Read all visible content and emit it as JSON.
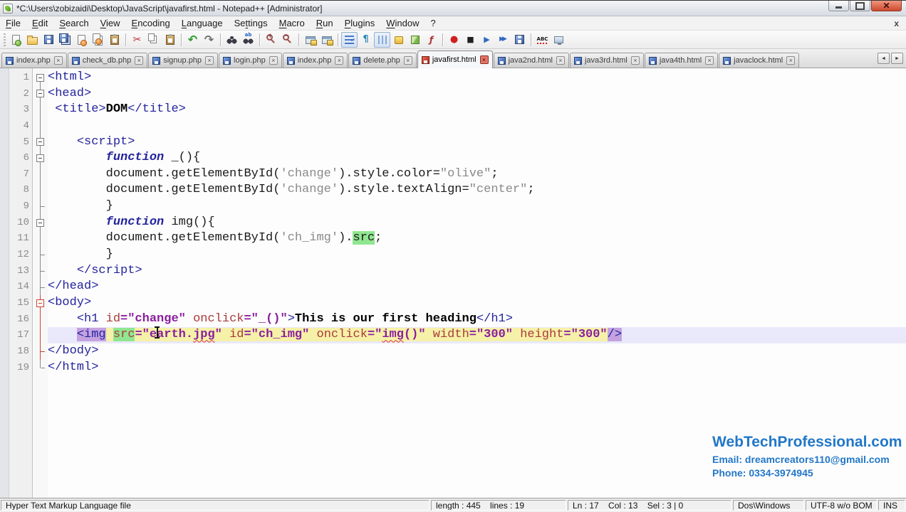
{
  "window": {
    "title": "*C:\\Users\\zobizaidi\\Desktop\\JavaScript\\javafirst.html - Notepad++ [Administrator]"
  },
  "menu": {
    "items": [
      {
        "label": "File",
        "u": 0
      },
      {
        "label": "Edit",
        "u": 0
      },
      {
        "label": "Search",
        "u": 0
      },
      {
        "label": "View",
        "u": 0
      },
      {
        "label": "Encoding",
        "u": 0
      },
      {
        "label": "Language",
        "u": 0
      },
      {
        "label": "Settings",
        "u": 2
      },
      {
        "label": "Macro",
        "u": 0
      },
      {
        "label": "Run",
        "u": 0
      },
      {
        "label": "Plugins",
        "u": 0
      },
      {
        "label": "Window",
        "u": 0
      },
      {
        "label": "?",
        "u": -1
      }
    ],
    "close_label": "x"
  },
  "toolbar": {
    "buttons": [
      {
        "name": "new-file",
        "k": "page"
      },
      {
        "name": "open-file",
        "k": "folder"
      },
      {
        "name": "save-file",
        "k": "floppy"
      },
      {
        "name": "save-all",
        "k": "floppy2"
      },
      {
        "name": "close-file",
        "k": "closedoc"
      },
      {
        "name": "close-all",
        "k": "closeall"
      },
      {
        "name": "print",
        "k": "paste"
      },
      {
        "sep": 1
      },
      {
        "name": "cut",
        "k": "cut",
        "g": "✂"
      },
      {
        "name": "copy",
        "k": "copy"
      },
      {
        "name": "paste",
        "k": "paste"
      },
      {
        "sep": 1
      },
      {
        "name": "undo",
        "k": "undo",
        "g": "↶"
      },
      {
        "name": "redo",
        "k": "redo",
        "g": "↷"
      },
      {
        "sep": 1
      },
      {
        "name": "find",
        "k": "find"
      },
      {
        "name": "replace",
        "k": "replace"
      },
      {
        "sep": 1
      },
      {
        "name": "zoom-in",
        "k": "zoomin"
      },
      {
        "name": "zoom-out",
        "k": "zoomout"
      },
      {
        "sep": 1
      },
      {
        "name": "sync-vertical-scrolling",
        "k": "sync"
      },
      {
        "name": "sync-horizontal-scrolling",
        "k": "sync"
      },
      {
        "sep": 1
      },
      {
        "name": "word-wrap",
        "k": "wrap",
        "pressed": 1
      },
      {
        "name": "show-all-characters",
        "k": "pilcrow",
        "g": "¶"
      },
      {
        "name": "show-indent-guide",
        "k": "guide",
        "pressed": 1
      },
      {
        "name": "define-your-language",
        "k": "lang"
      },
      {
        "name": "document-map",
        "k": "map"
      },
      {
        "name": "function-list",
        "k": "func",
        "g": "ƒ"
      },
      {
        "sep": 1
      },
      {
        "name": "macro-record",
        "k": "rec",
        "g": "●"
      },
      {
        "name": "macro-stop",
        "k": "stop",
        "g": "■"
      },
      {
        "name": "macro-playback",
        "k": "play",
        "g": "▶"
      },
      {
        "name": "macro-run-multiple",
        "k": "multi",
        "g": "▶▶"
      },
      {
        "name": "macro-save",
        "k": "msave"
      },
      {
        "sep": 1
      },
      {
        "name": "spell-check",
        "k": "spell",
        "g": "ABC"
      },
      {
        "name": "document-monitor",
        "k": "monitor"
      }
    ]
  },
  "tabs": {
    "items": [
      {
        "label": "index.php",
        "modified": false,
        "active": false
      },
      {
        "label": "check_db.php",
        "modified": false,
        "active": false
      },
      {
        "label": "signup.php",
        "modified": false,
        "active": false
      },
      {
        "label": "login.php",
        "modified": false,
        "active": false
      },
      {
        "label": "index.php",
        "modified": false,
        "active": false
      },
      {
        "label": "delete.php",
        "modified": false,
        "active": false
      },
      {
        "label": "javafirst.html",
        "modified": true,
        "active": true
      },
      {
        "label": "java2nd.html",
        "modified": false,
        "active": false
      },
      {
        "label": "java3rd.html",
        "modified": false,
        "active": false
      },
      {
        "label": "java4th.html",
        "modified": false,
        "active": false
      },
      {
        "label": "javaclock.html",
        "modified": false,
        "active": false
      }
    ],
    "close_glyph": "×",
    "scroll_left": "◄",
    "scroll_right": "►"
  },
  "editor": {
    "lines": [
      {
        "n": 1,
        "fold": "box",
        "top": 0,
        "tokens": [
          {
            "t": "<html>",
            "c": "tag"
          }
        ]
      },
      {
        "n": 2,
        "fold": "box",
        "top": 1,
        "tokens": [
          {
            "t": "<head>",
            "c": "tag"
          }
        ]
      },
      {
        "n": 3,
        "fold": "line",
        "tokens": [
          {
            "t": " "
          },
          {
            "t": "<title>",
            "c": "tag"
          },
          {
            "t": "DOM",
            "c": "bb"
          },
          {
            "t": "</title>",
            "c": "tag"
          }
        ]
      },
      {
        "n": 4,
        "fold": "line",
        "tokens": []
      },
      {
        "n": 5,
        "fold": "box",
        "top": 1,
        "tokens": [
          {
            "t": "    "
          },
          {
            "t": "<script>",
            "c": "tag"
          }
        ]
      },
      {
        "n": 6,
        "fold": "box",
        "top": 1,
        "tokens": [
          {
            "t": "        "
          },
          {
            "t": "function",
            "c": "kw"
          },
          {
            "t": " _(){"
          }
        ]
      },
      {
        "n": 7,
        "fold": "line",
        "tokens": [
          {
            "t": "        document.getElementById("
          },
          {
            "t": "'change'",
            "c": "str"
          },
          {
            "t": ").style.color="
          },
          {
            "t": "\"olive\"",
            "c": "str"
          },
          {
            "t": ";"
          }
        ]
      },
      {
        "n": 8,
        "fold": "line",
        "tokens": [
          {
            "t": "        document.getElementById("
          },
          {
            "t": "'change'",
            "c": "str"
          },
          {
            "t": ").style.textAlign="
          },
          {
            "t": "\"center\"",
            "c": "str"
          },
          {
            "t": ";"
          }
        ]
      },
      {
        "n": 9,
        "fold": "tee",
        "tokens": [
          {
            "t": "        }"
          }
        ]
      },
      {
        "n": 10,
        "fold": "box",
        "top": 1,
        "tokens": [
          {
            "t": "        "
          },
          {
            "t": "function",
            "c": "kw"
          },
          {
            "t": " img(){"
          }
        ]
      },
      {
        "n": 11,
        "fold": "line",
        "tokens": [
          {
            "t": "        document.getElementById("
          },
          {
            "t": "'ch_img'",
            "c": "str"
          },
          {
            "t": ")."
          },
          {
            "t": "src",
            "b": "g"
          },
          {
            "t": ";"
          }
        ]
      },
      {
        "n": 12,
        "fold": "tee",
        "tokens": [
          {
            "t": "        }"
          }
        ]
      },
      {
        "n": 13,
        "fold": "tee",
        "tokens": [
          {
            "t": "    "
          },
          {
            "t": "</script>",
            "c": "tag"
          }
        ]
      },
      {
        "n": 14,
        "fold": "tee",
        "tokens": [
          {
            "t": "</head>",
            "c": "tag"
          }
        ]
      },
      {
        "n": 15,
        "fold": "box",
        "top": 1,
        "red": 1,
        "tokens": [
          {
            "t": "<body>",
            "c": "tag"
          }
        ]
      },
      {
        "n": 16,
        "fold": "line",
        "red": 1,
        "tokens": [
          {
            "t": "    "
          },
          {
            "t": "<h1",
            "c": "tag"
          },
          {
            "t": " "
          },
          {
            "t": "id",
            "c": "attr"
          },
          {
            "t": "=\"change\"",
            "c": "val"
          },
          {
            "t": " "
          },
          {
            "t": "onclick",
            "c": "attr"
          },
          {
            "t": "=\"_()\"",
            "c": "val"
          },
          {
            "t": ">",
            "c": "tag"
          },
          {
            "t": "This is our first heading",
            "c": "bb"
          },
          {
            "t": "</h1>",
            "c": "tag"
          }
        ]
      },
      {
        "n": 17,
        "fold": "line",
        "red": 1,
        "cur": 1,
        "tokens": [
          {
            "t": "    "
          },
          {
            "t": "<img",
            "c": "tag",
            "b": "l"
          },
          {
            "t": " ",
            "b": "y"
          },
          {
            "t": "src",
            "c": "attr",
            "b": "g"
          },
          {
            "t": "=\"earth.",
            "c": "val",
            "b": "y"
          },
          {
            "t": "jpg",
            "c": "val",
            "b": "y",
            "u": 1
          },
          {
            "t": "\"",
            "c": "val",
            "b": "y"
          },
          {
            "t": " ",
            "b": "y"
          },
          {
            "t": "id",
            "c": "attr",
            "b": "y"
          },
          {
            "t": "=\"ch_img\"",
            "c": "val",
            "b": "y"
          },
          {
            "t": " ",
            "b": "y"
          },
          {
            "t": "onclick",
            "c": "attr",
            "b": "y"
          },
          {
            "t": "=\"",
            "c": "val",
            "b": "y"
          },
          {
            "t": "img",
            "c": "val",
            "b": "y",
            "u": 1
          },
          {
            "t": "()\"",
            "c": "val",
            "b": "y"
          },
          {
            "t": " ",
            "b": "y"
          },
          {
            "t": "width",
            "c": "attr",
            "b": "y"
          },
          {
            "t": "=\"300\"",
            "c": "val",
            "b": "y"
          },
          {
            "t": " ",
            "b": "y"
          },
          {
            "t": "height",
            "c": "attr",
            "b": "y"
          },
          {
            "t": "=\"300\"",
            "c": "val",
            "b": "y"
          },
          {
            "t": "/>",
            "c": "tag",
            "b": "l"
          }
        ]
      },
      {
        "n": 18,
        "fold": "tee",
        "red": 1,
        "tokens": [
          {
            "t": "</body>",
            "c": "tag"
          }
        ]
      },
      {
        "n": 19,
        "fold": "end",
        "tokens": [
          {
            "t": "</html>",
            "c": "tag"
          }
        ]
      }
    ]
  },
  "watermark": {
    "line1": "WebTechProfessional.com",
    "line2": "Email: dreamcreators110@gmail.com",
    "line3": "Phone: 0334-3974945",
    "color": "#2277c8"
  },
  "statusbar": {
    "doc_type": "Hyper Text Markup Language file",
    "length_lines": "length : 445    lines : 19",
    "cursor": "Ln : 17    Col : 13    Sel : 3 | 0",
    "eol": "Dos\\Windows",
    "encoding": "UTF-8 w/o BOM",
    "mode": "INS"
  }
}
